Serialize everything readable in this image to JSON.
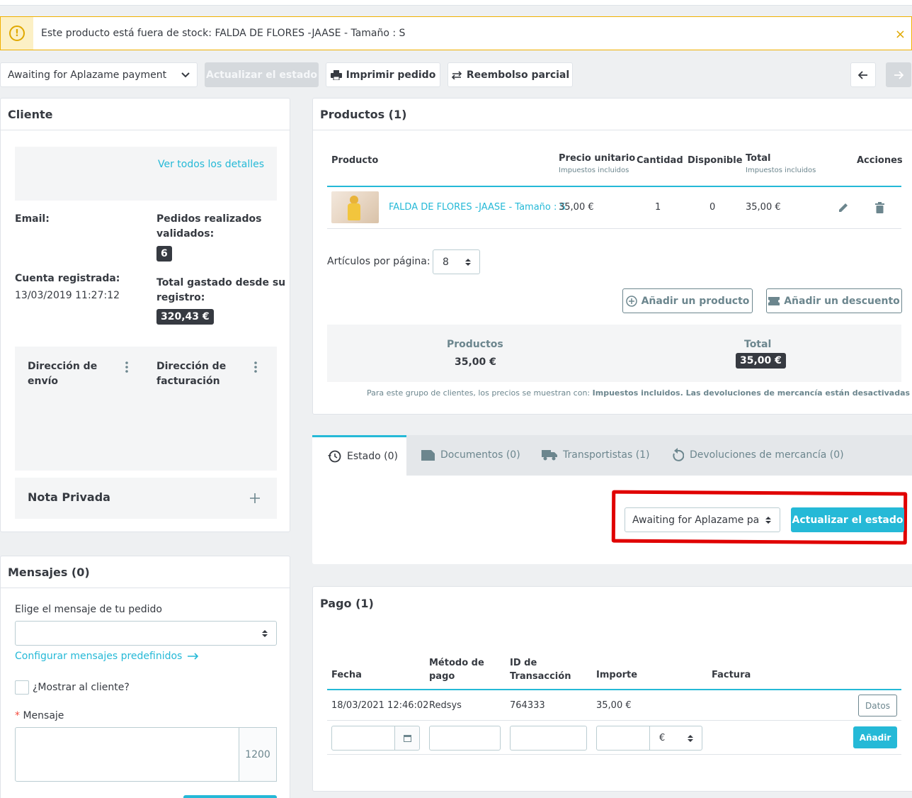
{
  "alert": {
    "message": "Este producto está fuera de stock: FALDA DE FLORES -JAASE - Tamaño : S",
    "icon": "warning-icon",
    "close_icon": "×"
  },
  "toolbar": {
    "status_select": "Awaiting for Aplazame payment",
    "update_status": "Actualizar el estado",
    "print_order": "Imprimir pedido",
    "partial_refund": "Reembolso parcial"
  },
  "customer": {
    "title": "Cliente",
    "view_details": "Ver todos los detalles",
    "email_label": "Email:",
    "orders_label_1": "Pedidos realizados",
    "orders_label_2": "validados:",
    "orders_count": "6",
    "registered_label": "Cuenta registrada:",
    "registered_date": "13/03/2019 11:27:12",
    "spent_label_1": "Total gastado desde su",
    "spent_label_2": "registro:",
    "spent_value": "320,43 €",
    "shipping_1": "Dirección de",
    "shipping_2": "envío",
    "billing_1": "Dirección de",
    "billing_2": "facturación",
    "private_note": "Nota Privada"
  },
  "messages": {
    "title": "Mensajes (0)",
    "choose_label": "Elige el mensaje de tu pedido",
    "configure_link": "Configurar mensajes predefinidos",
    "show_customer": "¿Mostrar al cliente?",
    "message_label": "Mensaje",
    "required_mark": "*",
    "char_count": "1200"
  },
  "products": {
    "title": "Productos (1)",
    "headers": {
      "product": "Producto",
      "unit_price": "Precio unitario",
      "unit_price_sub": "Impuestos incluidos",
      "quantity": "Cantidad",
      "available": "Disponible",
      "total": "Total",
      "total_sub": "Impuestos incluidos",
      "actions": "Acciones"
    },
    "row": {
      "name": "FALDA DE FLORES -JAASE - Tamaño : S",
      "unit_price": "35,00 €",
      "quantity": "1",
      "available": "0",
      "total": "35,00 €"
    },
    "per_page_label": "Artículos por página:",
    "per_page_value": "8",
    "add_product": "Añadir un producto",
    "add_discount": "Añadir un descuento",
    "summary_products_label": "Productos",
    "summary_products_value": "35,00 €",
    "summary_total_label": "Total",
    "summary_total_value": "35,00 €",
    "note_prefix": "Para este grupo de clientes, los precios se muestran con: ",
    "note_tax": "Impuestos incluidos",
    "note_returns": "Las devoluciones de mercancía están desactivadas"
  },
  "tabs": {
    "status": "Estado (0)",
    "documents": "Documentos (0)",
    "carriers": "Transportistas (1)",
    "returns": "Devoluciones de mercancía (0)",
    "status_select": "Awaiting for Aplazame payr",
    "update_button": "Actualizar el estado"
  },
  "payment": {
    "title": "Pago (1)",
    "headers": {
      "date": "Fecha",
      "method_1": "Método de",
      "method_2": "pago",
      "txn_1": "ID de",
      "txn_2": "Transacción",
      "amount": "Importe",
      "invoice": "Factura"
    },
    "row": {
      "date": "18/03/2021 12:46:02",
      "method": "Redsys",
      "txn": "764333",
      "amount": "35,00 €",
      "details_button": "Datos"
    },
    "currency": "€",
    "add_button": "Añadir"
  },
  "colors": {
    "accent": "#25b9d7",
    "warning": "#f0b000",
    "highlight": "#e00000"
  }
}
